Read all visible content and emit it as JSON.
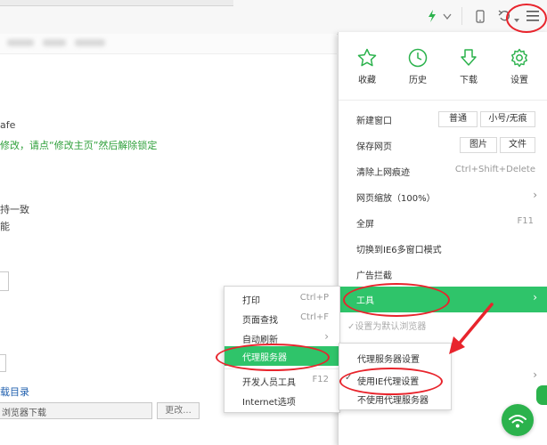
{
  "page_fragments": {
    "line1": "afe",
    "line2": "修改，请点“修改主页”然后解除锁定",
    "line3": "持一致",
    "line4": "能",
    "line5": "载目录",
    "download_path": "浏览器下载",
    "change_button": "更改..."
  },
  "toolbar": {
    "bolt_icon": "bolt-icon",
    "menu_icon": "hamburger-menu-icon"
  },
  "quick_actions": [
    {
      "label": "收藏",
      "icon": "star-icon"
    },
    {
      "label": "历史",
      "icon": "clock-icon"
    },
    {
      "label": "下载",
      "icon": "download-icon"
    },
    {
      "label": "设置",
      "icon": "gear-icon"
    }
  ],
  "menu": {
    "new_window": "新建窗口",
    "new_window_normal": "普通",
    "new_window_private": "小号/无痕",
    "save_page": "保存网页",
    "save_image": "图片",
    "save_file": "文件",
    "clear_traces": "清除上网痕迹",
    "clear_traces_shortcut": "Ctrl+Shift+Delete",
    "zoom": "网页缩放（100%）",
    "fullscreen": "全屏",
    "fullscreen_shortcut": "F11",
    "ie6_mode": "切换到IE6多窗口模式",
    "ad_block": "广告拦截",
    "tools": "工具",
    "set_default": "设置为默认浏览器"
  },
  "tools_submenu": [
    {
      "label": "打印",
      "shortcut": "Ctrl+P"
    },
    {
      "label": "页面查找",
      "shortcut": "Ctrl+F"
    },
    {
      "label": "自动刷新",
      "shortcut": ""
    },
    {
      "label": "代理服务器",
      "shortcut": ""
    },
    {
      "label": "开发人员工具",
      "shortcut": "F12"
    },
    {
      "label": "Internet选项",
      "shortcut": ""
    }
  ],
  "proxy_submenu": [
    {
      "label": "代理服务器设置",
      "checked": false
    },
    {
      "label": "使用IE代理设置",
      "checked": true
    },
    {
      "label": "不使用代理服务器",
      "checked": false
    }
  ],
  "colors": {
    "accent": "#2fc46a",
    "annotation": "#e8242c",
    "icon_green": "#2bb24c"
  }
}
